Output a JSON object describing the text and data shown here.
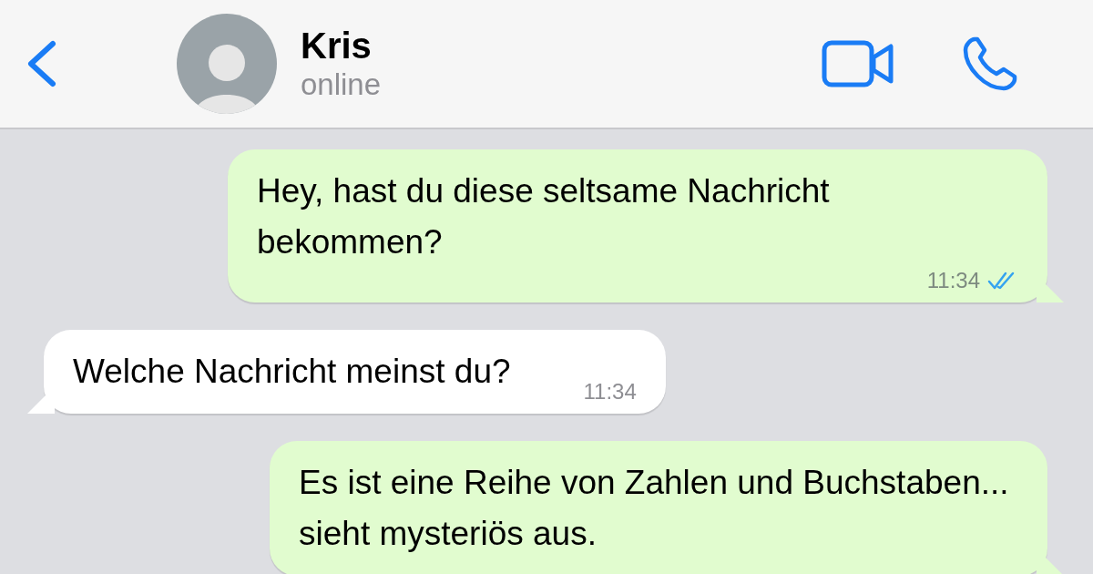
{
  "header": {
    "contact_name": "Kris",
    "status": "online"
  },
  "messages": [
    {
      "kind": "outgoing",
      "text": "Hey, hast du diese seltsame Nachricht bekommen?",
      "time": "11:34",
      "read": true
    },
    {
      "kind": "incoming",
      "text": "Welche Nachricht meinst du?",
      "time": "11:34"
    },
    {
      "kind": "outgoing",
      "text": "Es ist eine Reihe von Zahlen und Buchstaben... sieht mysteriös aus."
    }
  ]
}
